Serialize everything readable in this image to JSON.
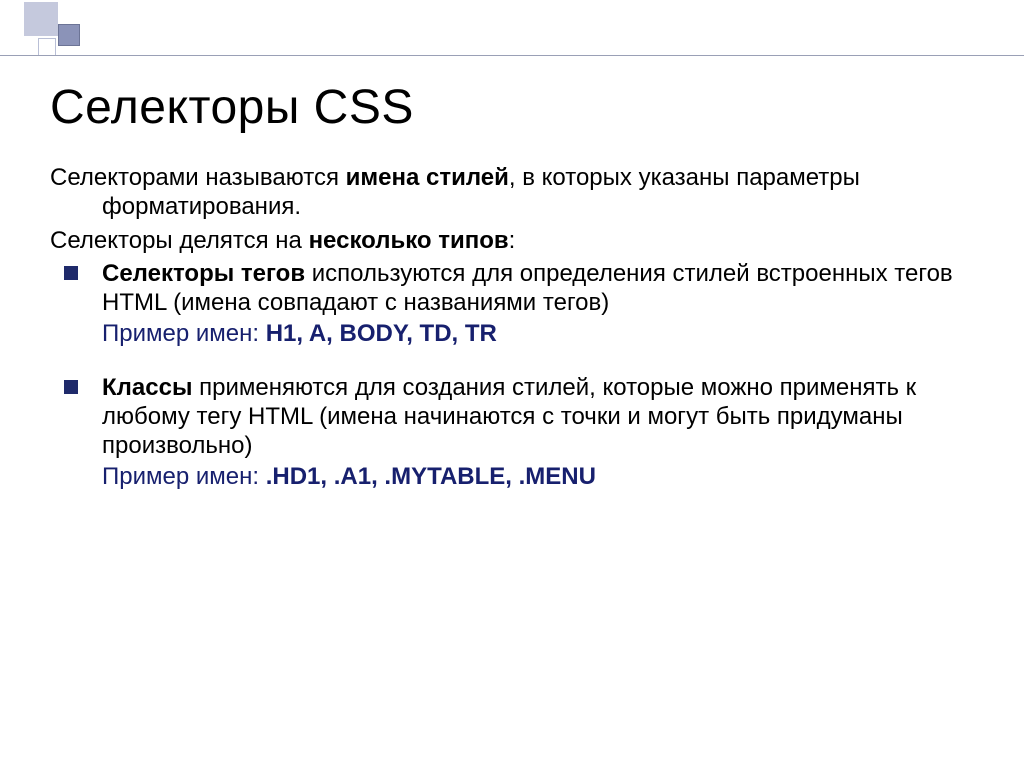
{
  "slide": {
    "title": "Селекторы CSS",
    "intro_1a": "Селекторами называются ",
    "intro_1b": "имена стилей",
    "intro_1c": ", в которых указаны параметры форматирования.",
    "intro_2a": "Селекторы делятся на ",
    "intro_2b": "несколько типов",
    "intro_2c": ":",
    "bullet1": {
      "lead": "Селекторы тегов",
      "rest": " используются для определения стилей встроенных тегов HTML (имена совпадают с названиями тегов)",
      "example_label": "Пример имен: ",
      "example_value": "H1, A, BODY, TD, TR"
    },
    "bullet2": {
      "lead": "Классы",
      "rest": " применяются для создания стилей, которые можно применять к любому тегу HTML (имена начинаются с точки и могут быть придуманы произвольно)",
      "example_label": "Пример имен: ",
      "example_value": ".HD1, .A1, .MYTABLE, .MENU"
    }
  }
}
